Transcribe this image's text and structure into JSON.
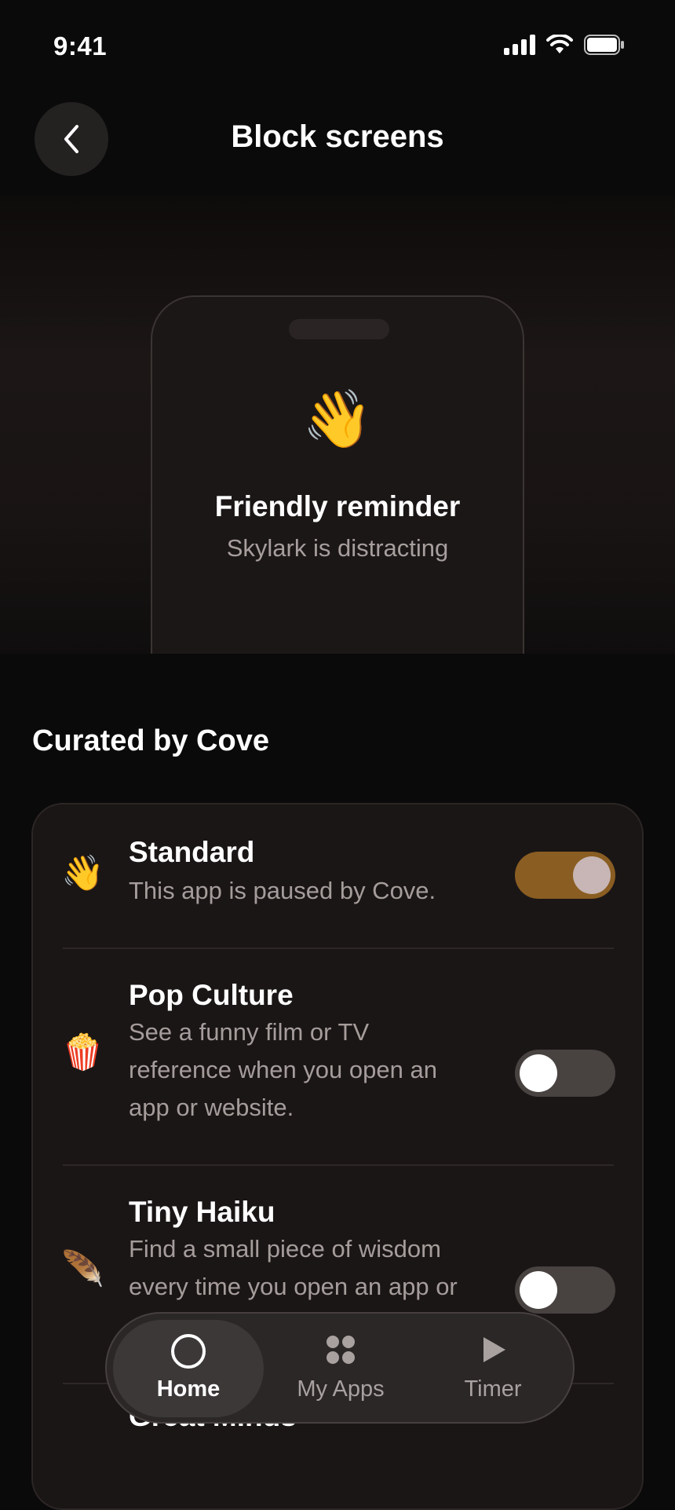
{
  "status_bar": {
    "time": "9:41",
    "icons": [
      "signal-icon",
      "wifi-icon",
      "battery-icon"
    ]
  },
  "header": {
    "title": "Block screens",
    "back_icon": "chevron-left-icon"
  },
  "preview": {
    "emoji": "👋",
    "title": "Friendly reminder",
    "subtitle": "Skylark is distracting"
  },
  "section": {
    "title": "Curated by Cove"
  },
  "options": [
    {
      "emoji": "👋",
      "name": "Standard",
      "description": "This app is paused by Cove.",
      "enabled": true
    },
    {
      "emoji": "🍿",
      "name": "Pop Culture",
      "description": "See a funny film or TV reference when you open an app or website.",
      "enabled": false
    },
    {
      "emoji": "🪶",
      "name": "Tiny Haiku",
      "description": "Find a small piece of wisdom every time you open an app or",
      "enabled": false
    },
    {
      "emoji": "",
      "name": "Great Minds",
      "description": "",
      "enabled": false
    }
  ],
  "tab_bar": {
    "tabs": [
      {
        "label": "Home",
        "icon": "circle-icon",
        "active": true
      },
      {
        "label": "My Apps",
        "icon": "apps-grid-icon",
        "active": false
      },
      {
        "label": "Timer",
        "icon": "play-icon",
        "active": false
      }
    ]
  },
  "colors": {
    "background": "#0b0a0a",
    "card": "#1b1616",
    "toggle_on": "#8a5d22",
    "toggle_off": "#484241",
    "tab_bar": "#2b2727"
  }
}
